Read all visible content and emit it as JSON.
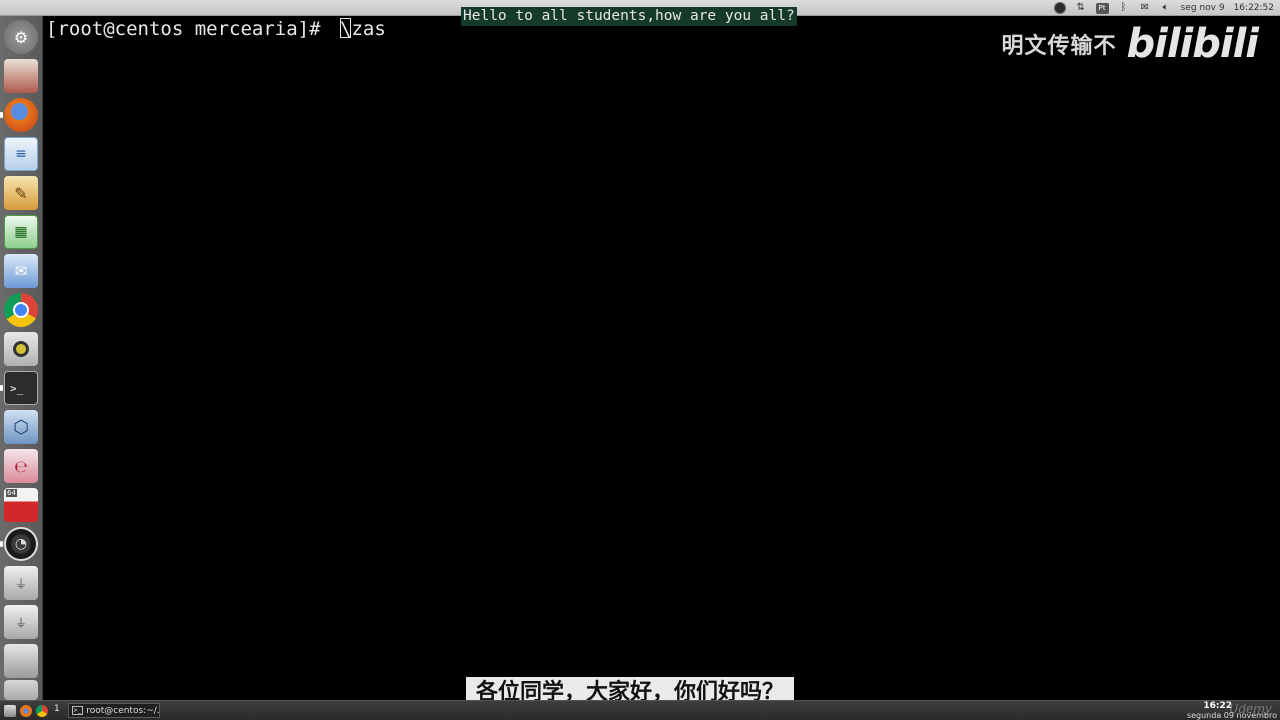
{
  "top_panel": {
    "keyboard": "Pt",
    "datetime": "seg nov 9",
    "clock": "16:22:52"
  },
  "terminal": {
    "prompt": "[root@centos mercearia]#",
    "typed": "\\zas"
  },
  "subtitle_en": "Hello to all students,how are you all?",
  "subtitle_zh": "各位同学，大家好，你们好吗？",
  "watermark": {
    "text": "明文传输不",
    "logo": "bilibili"
  },
  "taskbar": {
    "workspace": "1",
    "task_label": "root@centos:~/...",
    "clock_time": "16:22",
    "clock_date": "segunda 09 novembro",
    "watermark": "Udemy"
  },
  "colors": {
    "terminal_bg": "#000000",
    "subtitle_en_bg": "#163a2a",
    "subtitle_zh_bg": "#eaeaea"
  }
}
